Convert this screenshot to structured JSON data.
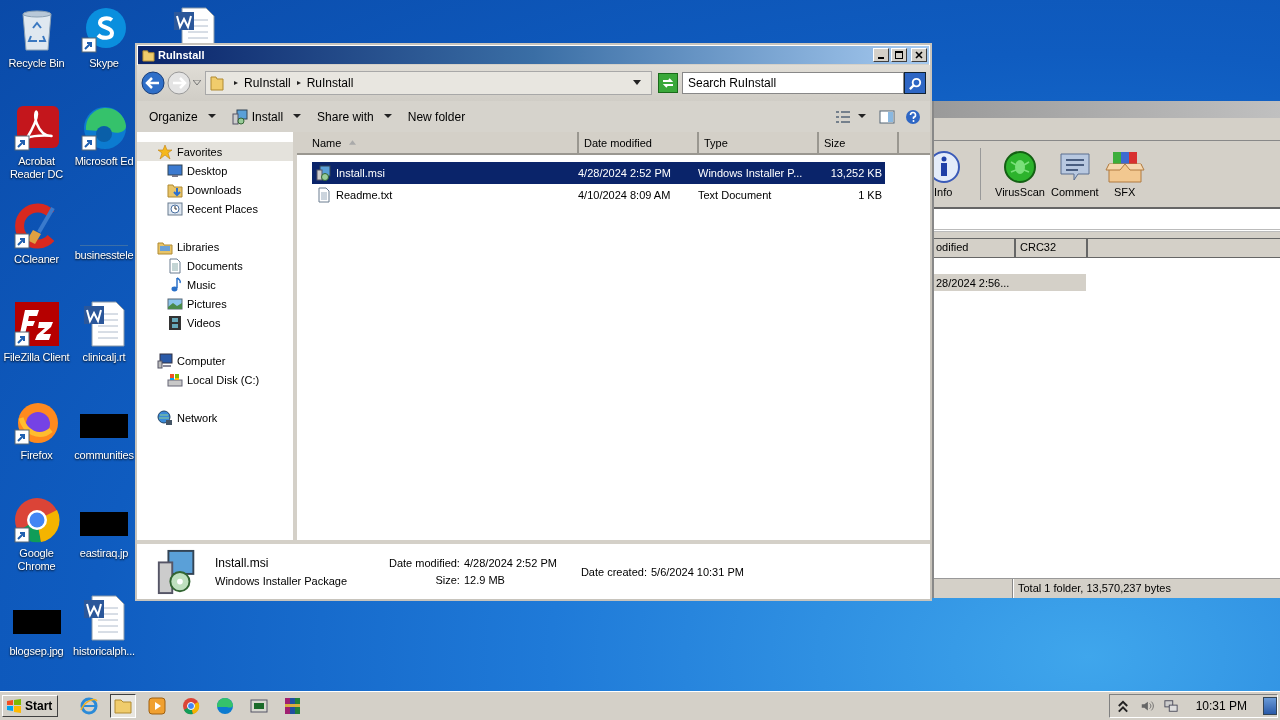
{
  "desktop_columns": [
    [
      {
        "label": "Recycle Bin",
        "kind": "recycle"
      },
      {
        "label": "Acrobat Reader DC",
        "kind": "acrobat"
      },
      {
        "label": "CCleaner",
        "kind": "ccleaner"
      },
      {
        "label": "FileZilla Client",
        "kind": "filezilla"
      },
      {
        "label": "Firefox",
        "kind": "firefox"
      },
      {
        "label": "Google Chrome",
        "kind": "chrome"
      },
      {
        "label": "blogsep.jpg",
        "kind": "image"
      }
    ],
    [
      {
        "label": "Skype",
        "kind": "skype"
      },
      {
        "label": "Microsoft Ed",
        "kind": "edge"
      },
      {
        "label": "businesstele",
        "kind": "blank"
      },
      {
        "label": "clinicalj.rt",
        "kind": "word"
      },
      {
        "label": "communities",
        "kind": "image"
      },
      {
        "label": "eastiraq.jp",
        "kind": "image"
      },
      {
        "label": "historicalph...",
        "kind": "word"
      }
    ],
    [
      {
        "kind": "word"
      }
    ]
  ],
  "winrar": {
    "toolbar": [
      {
        "label": "Info",
        "kind": "info"
      },
      {
        "label": "VirusScan",
        "kind": "virus"
      },
      {
        "label": "Comment",
        "kind": "comment"
      },
      {
        "label": "SFX",
        "kind": "sfx"
      }
    ],
    "columns": [
      "odified",
      "CRC32"
    ],
    "rows": [
      {
        "cells": [
          "28/2024 2:56...",
          ""
        ],
        "selected": true
      }
    ],
    "status": "Total 1 folder, 13,570,237 bytes"
  },
  "explorer": {
    "title": "RuInstall",
    "breadcrumb": [
      "RuInstall",
      "RuInstall"
    ],
    "search": {
      "placeholder": "Search RuInstall"
    },
    "toolbar": [
      {
        "label": "Organize",
        "kind": "menu"
      },
      {
        "label": "Install",
        "kind": "icon-menu"
      },
      {
        "label": "Share with",
        "kind": "menu"
      },
      {
        "label": "New folder",
        "kind": "plain"
      }
    ],
    "nav": [
      {
        "label": "Favorites",
        "kind": "star",
        "selected": true,
        "children": [
          {
            "label": "Desktop",
            "kind": "desktop",
            "selected": false
          },
          {
            "label": "Downloads",
            "kind": "downloads",
            "selected": false
          },
          {
            "label": "Recent Places",
            "kind": "recent",
            "selected": false
          }
        ]
      },
      {
        "label": "Libraries",
        "kind": "libraries",
        "selected": false,
        "children": [
          {
            "label": "Documents",
            "kind": "documents",
            "selected": false
          },
          {
            "label": "Music",
            "kind": "music",
            "selected": false
          },
          {
            "label": "Pictures",
            "kind": "pictures",
            "selected": false
          },
          {
            "label": "Videos",
            "kind": "videos",
            "selected": false
          }
        ]
      },
      {
        "label": "Computer",
        "kind": "computer",
        "selected": false,
        "children": [
          {
            "label": "Local Disk (C:)",
            "kind": "disk",
            "selected": false
          }
        ]
      },
      {
        "label": "Network",
        "kind": "network",
        "selected": false
      }
    ],
    "columns": [
      {
        "label": "Name",
        "sorted": true
      },
      {
        "label": "Date modified",
        "sorted": false
      },
      {
        "label": "Type",
        "sorted": false
      },
      {
        "label": "Size",
        "sorted": false
      }
    ],
    "files": [
      {
        "name": "Install.msi",
        "date": "4/28/2024 2:52 PM",
        "type": "Windows Installer P...",
        "size": "13,252 KB",
        "kind": "installer",
        "selected": true
      },
      {
        "name": "Readme.txt",
        "date": "4/10/2024 8:09 AM",
        "type": "Text Document",
        "size": "1 KB",
        "kind": "text",
        "selected": false
      }
    ],
    "details": {
      "name": "Install.msi",
      "type": "Windows Installer Package",
      "fields": [
        {
          "label": "Date modified:",
          "value": "4/28/2024 2:52 PM"
        },
        {
          "label": "Size:",
          "value": "12.9 MB"
        },
        {
          "label": "Date created:",
          "value": "5/6/2024 10:31 PM"
        }
      ]
    }
  },
  "taskbar": {
    "start": "Start",
    "items": [
      {
        "kind": "ie",
        "selected": false
      },
      {
        "kind": "folder",
        "selected": true
      },
      {
        "kind": "media",
        "selected": false
      },
      {
        "kind": "chrome",
        "selected": false
      },
      {
        "kind": "edge",
        "selected": false
      },
      {
        "kind": "terminal",
        "selected": false
      },
      {
        "kind": "winrar",
        "selected": false
      }
    ],
    "clock": "10:31 PM"
  }
}
